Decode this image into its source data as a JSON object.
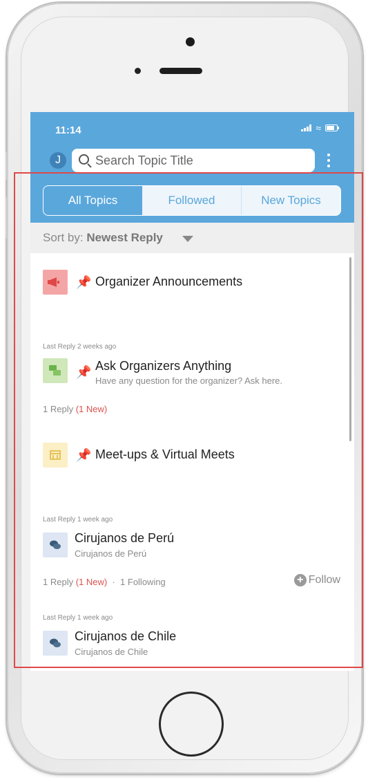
{
  "status_bar": {
    "time": "11:14"
  },
  "header": {
    "avatar_initial": "J",
    "search_placeholder": "Search Topic Title"
  },
  "tabs": [
    {
      "label": "All Topics",
      "active": true
    },
    {
      "label": "Followed",
      "active": false
    },
    {
      "label": "New Topics",
      "active": false
    }
  ],
  "sort": {
    "prefix": "Sort by:",
    "value": "Newest Reply"
  },
  "topics": [
    {
      "title": "Organizer Announcements",
      "icon": "megaphone-icon",
      "tile_color": "#f4a6a6",
      "pinned": true
    },
    {
      "last_reply": "Last Reply 2 weeks ago",
      "title": "Ask Organizers Anything",
      "subtitle": "Have any question for the organizer? Ask here.",
      "icon": "chat-icon",
      "tile_color": "#cfe7b9",
      "pinned": true,
      "replies": "1 Reply",
      "new": "(1 New)"
    },
    {
      "title": "Meet-ups & Virtual Meets",
      "icon": "calendar-icon",
      "tile_color": "#fbefc5",
      "pinned": true
    },
    {
      "last_reply": "Last Reply 1 week ago",
      "title": "Cirujanos de Perú",
      "subtitle": "Cirujanos de Perú",
      "icon": "discussion-icon",
      "tile_color": "#dde6f2",
      "pinned": false,
      "replies": "1 Reply",
      "new": "(1 New)",
      "separator": "·",
      "following": "1 Following",
      "follow_label": "Follow"
    },
    {
      "last_reply": "Last Reply 1 week ago",
      "title": "Cirujanos de Chile",
      "subtitle": "Cirujanos de Chile",
      "icon": "discussion-icon",
      "tile_color": "#dde6f2",
      "pinned": false
    }
  ],
  "colors": {
    "primary": "#5aa7dc",
    "new_badge": "#d9534f",
    "highlight": "#e04848"
  }
}
